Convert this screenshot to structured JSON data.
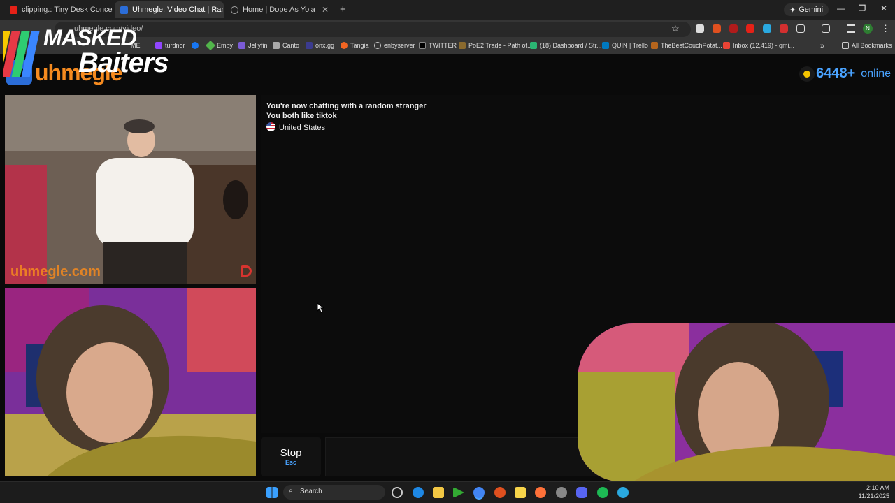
{
  "browser": {
    "tabs": [
      {
        "title": "clipping.: Tiny Desk Concert - Y",
        "icon": "youtube-icon",
        "active": false
      },
      {
        "title": "Uhmegle: Video Chat | Ran",
        "icon": "uhmegle-icon",
        "active": true
      },
      {
        "title": "Home | Dope As Yola",
        "icon": "loading-icon",
        "active": false
      }
    ],
    "new_tab": "+",
    "gemini_label": "Gemini",
    "url": "uhmegle.com/video/",
    "profile_initial": "N",
    "bookmarks": [
      {
        "label": "ME",
        "icon": "app-icon"
      },
      {
        "label": "turdnor",
        "icon": "twitch-icon"
      },
      {
        "label": "",
        "icon": "facebook-icon"
      },
      {
        "label": "Emby",
        "icon": "emby-icon"
      },
      {
        "label": "Jellyfin",
        "icon": "jellyfin-icon"
      },
      {
        "label": "Canto",
        "icon": "canto-icon"
      },
      {
        "label": "onx.gg",
        "icon": "onx-icon"
      },
      {
        "label": "Tangia",
        "icon": "tangia-icon"
      },
      {
        "label": "enbyserver",
        "icon": "globe-icon"
      },
      {
        "label": "TWITTER",
        "icon": "x-icon"
      },
      {
        "label": "PoE2 Trade - Path of...",
        "icon": "poe-icon"
      },
      {
        "label": "(18) Dashboard / Str...",
        "icon": "dashboard-icon"
      },
      {
        "label": "QUIN | Trello",
        "icon": "trello-icon"
      },
      {
        "label": "TheBestCouchPotat...",
        "icon": "potato-icon"
      },
      {
        "label": "Inbox (12,419) - qmi...",
        "icon": "gmail-icon"
      }
    ],
    "bookmarks_overflow": "»",
    "all_bookmarks": "All Bookmarks"
  },
  "site": {
    "logo_text": "uhmegle",
    "online_count": "6448+",
    "online_label": "online",
    "cam_watermark": "uhmegle.com",
    "chat": {
      "line1": "You're now chatting with a random stranger",
      "line2": "You both like tiktok",
      "country": "United States"
    },
    "stop_label": "Stop",
    "stop_key": "Esc"
  },
  "overlay": {
    "logo_line1": "MASKED",
    "logo_line2": "Baiters"
  },
  "taskbar": {
    "search_placeholder": "Search",
    "time": "2:10 AM",
    "date": "11/21/2025"
  },
  "colors": {
    "accent_blue": "#4aa3ff",
    "brand_orange": "#f58a1f",
    "online_dot": "#f5c400"
  }
}
